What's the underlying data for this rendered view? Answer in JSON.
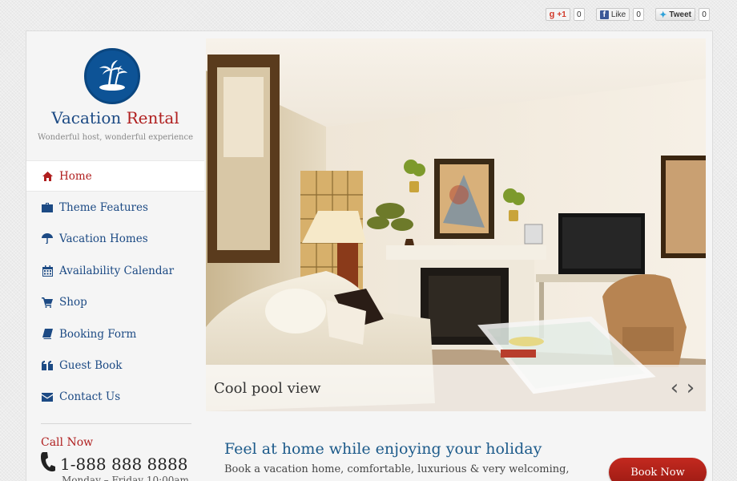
{
  "social": {
    "gplus_label": "+1",
    "gplus_count": "0",
    "fb_label": "Like",
    "fb_count": "0",
    "tweet_label": "Tweet",
    "tweet_count": "0"
  },
  "brand": {
    "name_part1": "Vacation",
    "name_part2": "Rental",
    "tagline": "Wonderful host, wonderful experience",
    "accent_color": "#b01f1f",
    "primary_color": "#1c4a84"
  },
  "nav": {
    "items": [
      {
        "label": "Home",
        "icon": "home-icon",
        "active": true
      },
      {
        "label": "Theme Features",
        "icon": "briefcase-icon"
      },
      {
        "label": "Vacation Homes",
        "icon": "umbrella-icon"
      },
      {
        "label": "Availability Calendar",
        "icon": "calendar-icon"
      },
      {
        "label": "Shop",
        "icon": "cart-icon"
      },
      {
        "label": "Booking Form",
        "icon": "book-icon"
      },
      {
        "label": "Guest Book",
        "icon": "quote-icon"
      },
      {
        "label": "Contact Us",
        "icon": "envelope-icon"
      }
    ]
  },
  "contact": {
    "call_now": "Call Now",
    "phone": "1-888 888 8888",
    "hours": "Monday – Friday 10:00am"
  },
  "hero": {
    "caption": "Cool pool view"
  },
  "content": {
    "title": "Feel at home while enjoying your holiday",
    "subtitle": "Book a vacation home, comfortable, luxurious & very welcoming,",
    "cta_label": "Book Now"
  }
}
